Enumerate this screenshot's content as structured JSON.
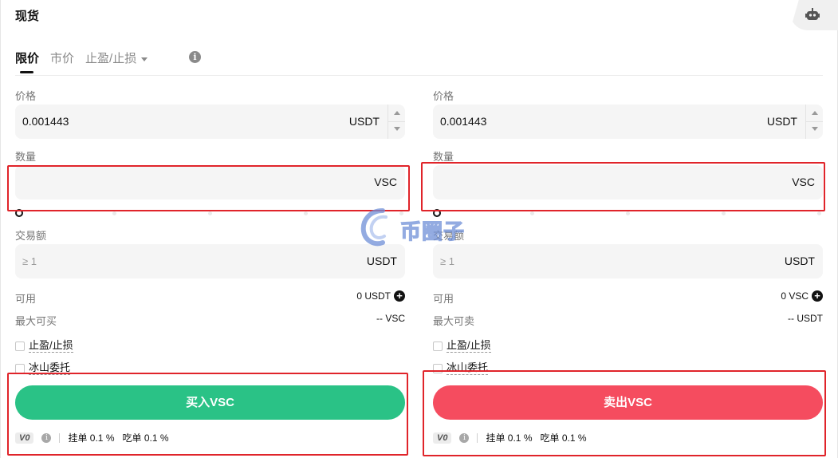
{
  "header": {
    "title": "现货",
    "robot_icon": "robot-icon"
  },
  "tabs": [
    {
      "label": "限价",
      "active": true
    },
    {
      "label": "市价",
      "active": false
    },
    {
      "label": "止盈/止损",
      "active": false,
      "dropdown": true
    }
  ],
  "buy": {
    "price_label": "价格",
    "price_value": "0.001443",
    "price_unit": "USDT",
    "amount_label": "数量",
    "amount_value": "",
    "amount_unit": "VSC",
    "total_label": "交易额",
    "total_placeholder": "≥ 1",
    "total_unit": "USDT",
    "available_label": "可用",
    "available_value": "0 USDT",
    "max_label": "最大可买",
    "max_value": "-- VSC",
    "tpsl_label": "止盈/止损",
    "iceberg_label": "冰山委托",
    "button_label": "买入VSC",
    "fee_tier": "V0",
    "maker_fee": "挂单 0.1 %",
    "taker_fee": "吃单 0.1 %",
    "slider_percent": 0
  },
  "sell": {
    "price_label": "价格",
    "price_value": "0.001443",
    "price_unit": "USDT",
    "amount_label": "数量",
    "amount_value": "",
    "amount_unit": "VSC",
    "total_label": "交易额",
    "total_placeholder": "≥ 1",
    "total_unit": "USDT",
    "available_label": "可用",
    "available_value": "0 VSC",
    "max_label": "最大可卖",
    "max_value": "-- USDT",
    "tpsl_label": "止盈/止损",
    "iceberg_label": "冰山委托",
    "button_label": "卖出VSC",
    "fee_tier": "V0",
    "maker_fee": "挂单 0.1 %",
    "taker_fee": "吃单 0.1 %",
    "slider_percent": 0
  },
  "watermark": {
    "text": "币圈子"
  },
  "colors": {
    "buy": "#2ac286",
    "sell": "#f54c5f",
    "highlight": "#e0242a"
  }
}
